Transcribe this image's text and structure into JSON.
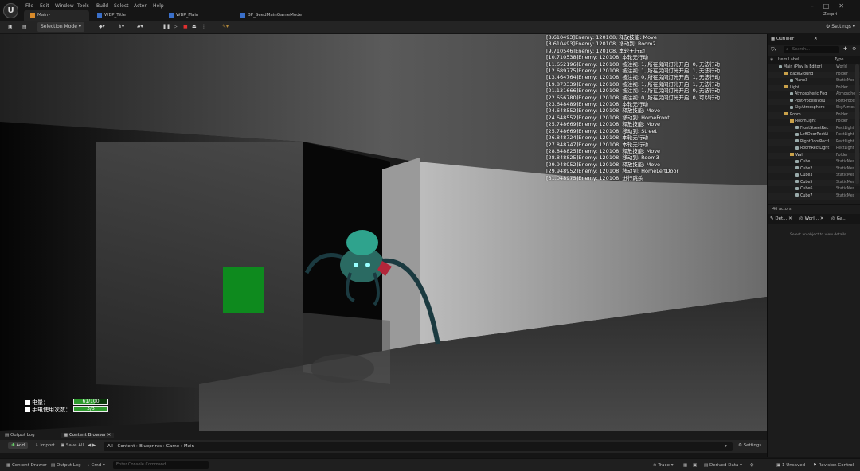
{
  "menu": [
    "File",
    "Edit",
    "Window",
    "Tools",
    "Build",
    "Select",
    "Actor",
    "Help"
  ],
  "doc_tabs": [
    {
      "label": "Main•",
      "active": true
    },
    {
      "label": "WBP_Title",
      "active": false
    },
    {
      "label": "WBP_Main",
      "active": false
    },
    {
      "label": "BP_SeedMainGameMode",
      "active": false
    }
  ],
  "user": "Zespri",
  "toolbar": {
    "selection_mode": "Selection Mode",
    "settings": "Settings"
  },
  "log_lines": [
    "[8.610493]Enemy: 120108, 释放技能: Move",
    "[8.610493]Enemy: 120108, 移动到: Room2",
    "[9.710546]Enemy: 120108, 本轮无行动",
    "[10.710538]Enemy: 120108, 本轮无行动",
    "[11.652196]Enemy: 120108, 被注视: 1, 所在房间灯光开启: 0, 无法行动",
    "[12.689775]Enemy: 120108, 被注视: 1, 所在房间灯光开启: 1, 无法行动",
    "[13.464764]Enemy: 120108, 被注视: 0, 所在房间灯光开启: 1, 无法行动",
    "[19.873339]Enemy: 120108, 被注视: 1, 所在房间灯光开启: 1, 无法行动",
    "[21.131666]Enemy: 120108, 被注视: 1, 所在房间灯光开启: 0, 无法行动",
    "[22.656780]Enemy: 120108, 被注视: 0, 所在房间灯光开启: 0, 可以行动",
    "[23.648489]Enemy: 120108, 本轮无行动",
    "[24.648552]Enemy: 120108, 释放技能: Move",
    "[24.648552]Enemy: 120108, 移动到: HomeFront",
    "[25.748669]Enemy: 120108, 释放技能: Move",
    "[25.748669]Enemy: 120108, 移动到: Street",
    "[26.848724]Enemy: 120108, 本轮无行动",
    "[27.848747]Enemy: 120108, 本轮无行动",
    "[28.848825]Enemy: 120108, 释放技能: Move",
    "[28.848825]Enemy: 120108, 移动到: Room3",
    "[29.948952]Enemy: 120108, 释放技能: Move",
    "[29.948952]Enemy: 120108, 移动到: HomeLeftDoor",
    "[31.048975]Enemy: 120108, 进行跳杀"
  ],
  "hud": {
    "battery_label": "电量：",
    "battery_value": "61/100",
    "battery_fraction": 0.61,
    "flashlight_label": "手电使用次数：",
    "flashlight_value": "3/3",
    "flashlight_fraction": 1.0
  },
  "outliner": {
    "title": "Outliner",
    "search_placeholder": "Search...",
    "col_label": "Item Label",
    "col_type": "Type",
    "rows": [
      {
        "indent": 0,
        "label": "Main (Play In Editor)",
        "type": "World",
        "icon": "world"
      },
      {
        "indent": 1,
        "label": "BackGround",
        "type": "Folder",
        "icon": "folder"
      },
      {
        "indent": 2,
        "label": "Plane3",
        "type": "StaticMes",
        "icon": "actor"
      },
      {
        "indent": 1,
        "label": "Light",
        "type": "Folder",
        "icon": "folder"
      },
      {
        "indent": 2,
        "label": "Atmospheric Fog",
        "type": "Atmospheric",
        "icon": "actor"
      },
      {
        "indent": 2,
        "label": "PostProcessVolu",
        "type": "PostProces",
        "icon": "actor"
      },
      {
        "indent": 2,
        "label": "SkyAtmosphere",
        "type": "SkyAtmos",
        "icon": "actor"
      },
      {
        "indent": 1,
        "label": "Room",
        "type": "Folder",
        "icon": "folder"
      },
      {
        "indent": 2,
        "label": "RoomLight",
        "type": "Folder",
        "icon": "folder"
      },
      {
        "indent": 3,
        "label": "FrontStreetRec",
        "type": "RectLight",
        "icon": "actor"
      },
      {
        "indent": 3,
        "label": "LeftDoorRectLi",
        "type": "RectLight",
        "icon": "actor"
      },
      {
        "indent": 3,
        "label": "RightDoorRectL",
        "type": "RectLight",
        "icon": "actor"
      },
      {
        "indent": 3,
        "label": "RoomRectLight",
        "type": "RectLight",
        "icon": "actor"
      },
      {
        "indent": 2,
        "label": "Wall",
        "type": "Folder",
        "icon": "folder"
      },
      {
        "indent": 3,
        "label": "Cube",
        "type": "StaticMes",
        "icon": "actor"
      },
      {
        "indent": 3,
        "label": "Cube2",
        "type": "StaticMes",
        "icon": "actor"
      },
      {
        "indent": 3,
        "label": "Cube3",
        "type": "StaticMes",
        "icon": "actor"
      },
      {
        "indent": 3,
        "label": "Cube5",
        "type": "StaticMes",
        "icon": "actor"
      },
      {
        "indent": 3,
        "label": "Cube6",
        "type": "StaticMes",
        "icon": "actor"
      },
      {
        "indent": 3,
        "label": "Cube7",
        "type": "StaticMes",
        "icon": "actor"
      }
    ],
    "actor_count": "46 actors"
  },
  "details": {
    "tabs": [
      "Det...",
      "Worl...",
      "Ga..."
    ],
    "empty_text": "Select an object to view details."
  },
  "bottom_tabs": [
    "Output Log",
    "Content Browser"
  ],
  "content_bar": {
    "add": "Add",
    "import": "Import",
    "save_all": "Save All",
    "path": [
      "All",
      "Content",
      "Blueprints",
      "Game",
      "Main"
    ],
    "settings": "Settings"
  },
  "status": {
    "content_drawer": "Content Drawer",
    "output_log": "Output Log",
    "cmd": "Cmd",
    "console_placeholder": "Enter Console Command",
    "trace": "Trace",
    "derived_data": "Derived Data",
    "unsaved": "1 Unsaved",
    "revision_control": "Revision Control"
  },
  "colors": {
    "accent": "#2f6fdf",
    "hud_green": "#2e9a2e",
    "folder": "#c9a14a"
  }
}
